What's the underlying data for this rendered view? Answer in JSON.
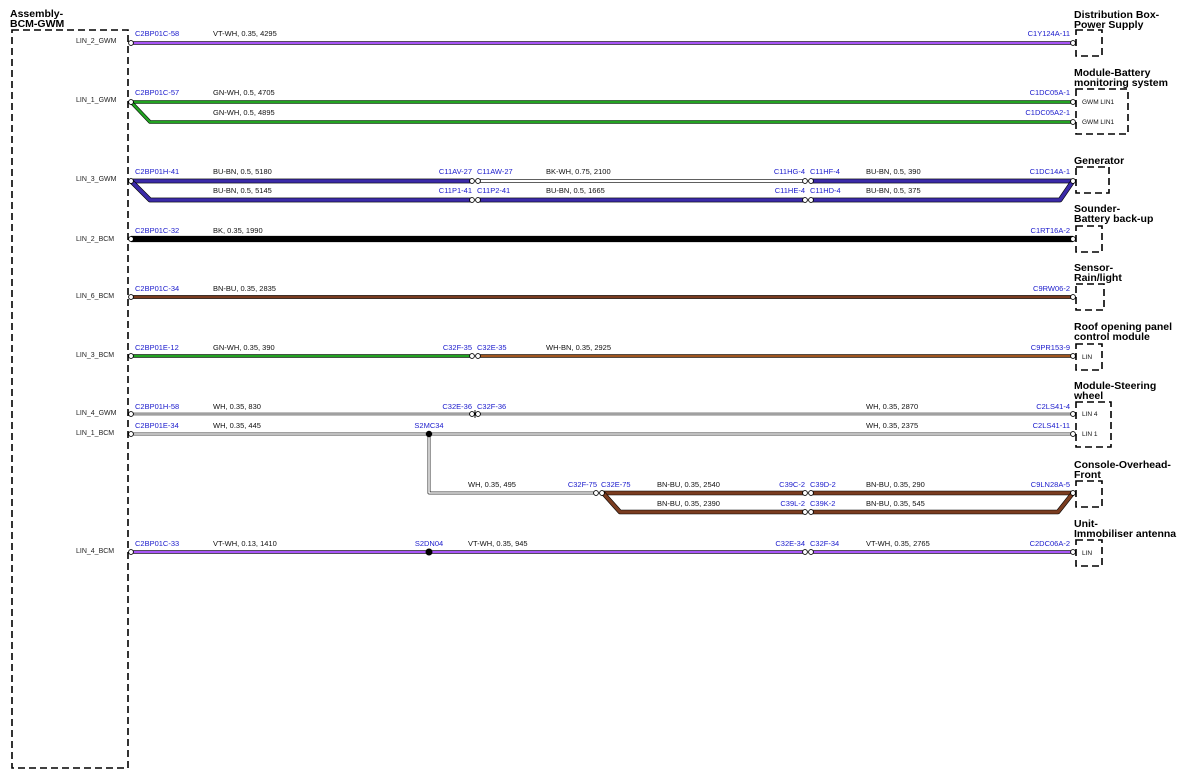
{
  "left_module": {
    "title_1": "Assembly-",
    "title_2": "BCM-GWM"
  },
  "colors": {
    "VT-WH": "#a855f7",
    "GN-WH": "#22a322",
    "BU-BN": "#3b2aa8",
    "BK-WH": "#1a1a1a",
    "BK": "#000000",
    "BN-BU": "#7a3c20",
    "WH-BN": "#a0561f",
    "WH": "#ffffff",
    "junction": "#000000"
  },
  "modules": [
    {
      "key": "dist",
      "lines": [
        "Distribution Box-",
        "Power Supply"
      ],
      "pins": []
    },
    {
      "key": "batt",
      "lines": [
        "Module-Battery",
        "monitoring system"
      ],
      "pins": [
        "GWM LIN1",
        "GWM LIN1"
      ]
    },
    {
      "key": "gen",
      "lines": [
        "Generator"
      ],
      "pins": []
    },
    {
      "key": "sounder",
      "lines": [
        "Sounder-",
        "Battery back-up"
      ],
      "pins": []
    },
    {
      "key": "sensor",
      "lines": [
        "Sensor-",
        "Rain/light"
      ],
      "pins": []
    },
    {
      "key": "roof",
      "lines": [
        "Roof opening panel",
        "control module"
      ],
      "pins": [
        "LIN"
      ]
    },
    {
      "key": "steer",
      "lines": [
        "Module-Steering",
        "wheel"
      ],
      "pins": [
        "LIN 4",
        "LIN 1"
      ]
    },
    {
      "key": "console",
      "lines": [
        "Console-Overhead-",
        "Front"
      ],
      "pins": []
    },
    {
      "key": "immob",
      "lines": [
        "Unit-",
        "Immobiliser antenna"
      ],
      "pins": [
        "LIN"
      ]
    }
  ],
  "signals": [
    "LIN_2_GWM",
    "LIN_1_GWM",
    "LIN_3_GWM",
    "LIN_2_BCM",
    "LIN_6_BCM",
    "LIN_3_BCM",
    "LIN_4_GWM",
    "LIN_1_BCM",
    "LIN_4_BCM"
  ],
  "connectors": {
    "r1_l": "C2BP01C-58",
    "r1_r": "C1Y124A-11",
    "r2_l": "C2BP01C-57",
    "r2_r1": "C1DC05A-1",
    "r2_r2": "C1DC05A2-1",
    "r3_l": "C2BP01H-41",
    "r3_a1": "C11AV-27",
    "r3_a2": "C11AW-27",
    "r3_b1": "C11HG-4",
    "r3_b2": "C11HF-4",
    "r3_r": "C1DC14A-1",
    "r3_c1": "C11P1-41",
    "r3_c2": "C11P2-41",
    "r3_d1": "C11HE-4",
    "r3_d2": "C11HD-4",
    "r4_l": "C2BP01C-32",
    "r4_r": "C1RT16A-2",
    "r5_l": "C2BP01C-34",
    "r5_r": "C9RW06-2",
    "r6_l": "C2BP01E-12",
    "r6_a1": "C32F-35",
    "r6_a2": "C32E-35",
    "r6_r": "C9PR153-9",
    "r7_l": "C2BP01H-58",
    "r7_a1": "C32E-36",
    "r7_a2": "C32F-36",
    "r7_r": "C2LS41-4",
    "r8_l": "C2BP01E-34",
    "r8_splice": "S2MC34",
    "r8_r": "C2LS41-11",
    "r9_a1": "C32F-75",
    "r9_a2": "C32E-75",
    "r9_b1": "C39C-2",
    "r9_b2": "C39D-2",
    "r9_r": "C9LN28A-5",
    "r9_c1": "C39L-2",
    "r9_c2": "C39K-2",
    "r10_l": "C2BP01C-33",
    "r10_splice": "S2DN04",
    "r10_a1": "C32E-34",
    "r10_a2": "C32F-34",
    "r10_r": "C2DC06A-2"
  },
  "wires": {
    "w1": "VT-WH,  0.35,  4295",
    "w2a": "GN-WH,  0.5,  4705",
    "w2b": "GN-WH,  0.5,  4895",
    "w3a": "BU-BN,  0.5,  5180",
    "w3b": "BK-WH,  0.75,  2100",
    "w3c": "BU-BN,  0.5,  390",
    "w3d": "BU-BN,  0.5,  5145",
    "w3e": "BU-BN,  0.5,  1665",
    "w3f": "BU-BN,  0.5,  375",
    "w4": "BK,  0.35,  1990",
    "w5": "BN-BU,  0.35,  2835",
    "w6a": "GN-WH,  0.35,  390",
    "w6b": "WH-BN,  0.35,  2925",
    "w7a": "WH,  0.35,  830",
    "w7b": "WH,  0.35,  2870",
    "w8a": "WH,  0.35,  445",
    "w8b": "WH,  0.35,  2375",
    "w9a": "WH,  0.35,  495",
    "w9b": "BN-BU,  0.35,  2540",
    "w9c": "BN-BU,  0.35,  290",
    "w9d": "BN-BU,  0.35,  2390",
    "w9e": "BN-BU,  0.35,  545",
    "w10a": "VT-WH,  0.13,  1410",
    "w10b": "VT-WH,  0.35,  945",
    "w10c": "VT-WH,  0.35,  2765"
  }
}
